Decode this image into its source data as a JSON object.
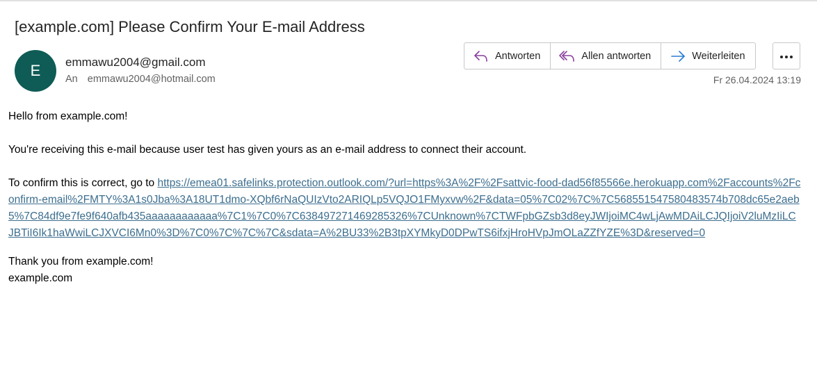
{
  "email": {
    "subject": "[example.com] Please Confirm Your E-mail Address",
    "avatar_initial": "E",
    "avatar_color": "#0e5c55",
    "sender": "emmawu2004@gmail.com",
    "to_label": "An",
    "to_address": "emmawu2004@hotmail.com",
    "date": "Fr 26.04.2024 13:19"
  },
  "actions": {
    "reply": {
      "label": "Antworten",
      "icon": "reply-icon",
      "color": "#8a3f9e"
    },
    "reply_all": {
      "label": "Allen antworten",
      "icon": "reply-all-icon",
      "color": "#8a3f9e"
    },
    "forward": {
      "label": "Weiterleiten",
      "icon": "forward-icon",
      "color": "#2b7cd3"
    },
    "more": {
      "icon": "more-icon"
    }
  },
  "body": {
    "greeting": "Hello from example.com!",
    "paragraph": "You're receiving this e-mail because user test has given yours as an e-mail address to connect their account.",
    "confirm_prefix": "To confirm this is correct, go to ",
    "confirm_link": "https://emea01.safelinks.protection.outlook.com/?url=https%3A%2F%2Fsattvic-food-dad56f85566e.herokuapp.com%2Faccounts%2Fconfirm-email%2FMTY%3A1s0Jba%3A18UT1dmo-XQbf6rNaQUIzVto2ARIQLp5VQJO1FMyxvw%2F&data=05%7C02%7C%7C568551547580483574b708dc65e2aeb5%7C84df9e7fe9f640afb435aaaaaaaaaaaa%7C1%7C0%7C638497271469285326%7CUnknown%7CTWFpbGZsb3d8eyJWIjoiMC4wLjAwMDAiLCJQIjoiV2luMzIiLCJBTiI6Ik1haWwiLCJXVCI6Mn0%3D%7C0%7C%7C%7C&sdata=A%2BU33%2B3tpXYMkyD0DPwTS6ifxjHroHVpJmOLaZZfYZE%3D&reserved=0",
    "thanks": "Thank you from example.com!",
    "signature": "example.com",
    "link_color": "#3c6e8f"
  }
}
